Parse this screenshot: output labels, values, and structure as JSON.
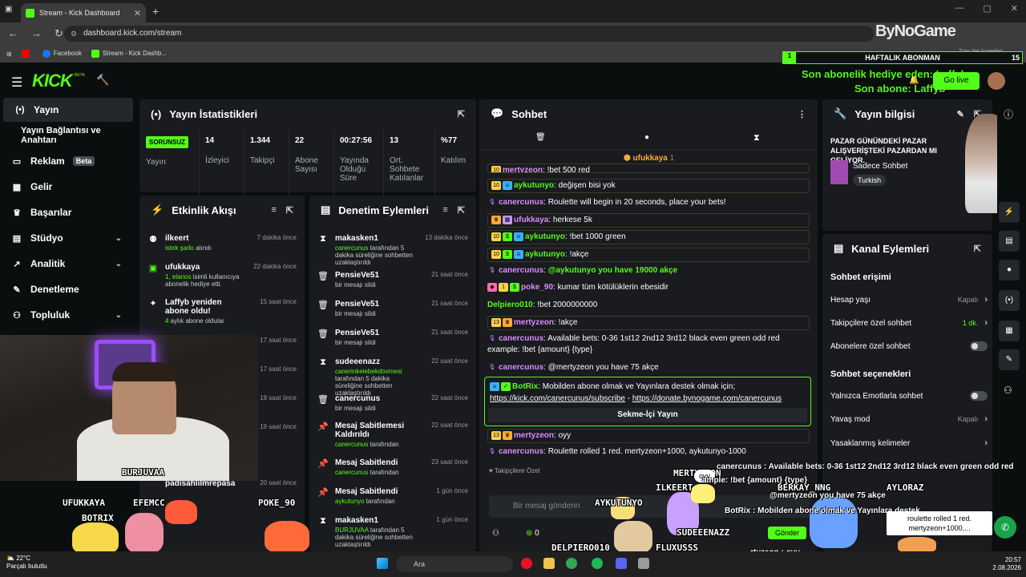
{
  "browser": {
    "tab_title": "Stream - Kick Dashboard",
    "url": "dashboard.kick.com/stream",
    "bookmarks": [
      "Facebook",
      "Stream - Kick Dashb..."
    ],
    "all_bookmarks": "Tüm Yer İşaretleri",
    "logo_overlay": "ByNoGame"
  },
  "overlay_top": {
    "weekly_label": "HAFTALIK ABONMAN",
    "weekly_left": "1",
    "weekly_right": "15",
    "gift_msg": "Son abonelik hediye eden: Laffyba",
    "last_sub": "Son abone: Laffyb"
  },
  "header": {
    "logo": "KICK",
    "beta": "BETA",
    "go_live": "Go live"
  },
  "sidebar": {
    "items": [
      {
        "label": "Yayın",
        "icon": "((•))"
      },
      {
        "label": "Yayın Bağlantısı ve Anahtarı",
        "icon": ""
      },
      {
        "label": "Reklam",
        "icon": "▭",
        "badge": "Beta"
      },
      {
        "label": "Gelir",
        "icon": "▦"
      },
      {
        "label": "Başarılar",
        "icon": "🏆"
      },
      {
        "label": "Stüdyo",
        "icon": "▤"
      },
      {
        "label": "Analitik",
        "icon": "📈"
      },
      {
        "label": "Denetleme",
        "icon": "🔧"
      },
      {
        "label": "Topluluk",
        "icon": "👥"
      }
    ]
  },
  "stats": {
    "title": "Yayın İstatistikleri",
    "status_badge": "SORUNSUZ",
    "cols": [
      {
        "value": "",
        "label": "Yayın"
      },
      {
        "value": "14",
        "label": "İzleyici"
      },
      {
        "value": "1.344",
        "label": "Takipçi"
      },
      {
        "value": "22",
        "label": "Abone Sayısı"
      },
      {
        "value": "00:27:56",
        "label": "Yayında Olduğu Süre"
      },
      {
        "value": "13",
        "label": "Ort. Sohbete Katılanlar"
      },
      {
        "value": "%77",
        "label": "Katılım"
      }
    ]
  },
  "activity": {
    "title": "Etkinlik Akışı",
    "items": [
      {
        "name": "ilkeert",
        "sub_hl": "istek şarkı",
        "sub": " alındı",
        "time": "7 dakika önce"
      },
      {
        "name": "ufukkaya",
        "sub_hl": "1, elanos",
        "sub": " isimli kullanıcıya abonelik hediye etti.",
        "time": "22 dakika önce"
      },
      {
        "name": "Laffyb yeniden abone oldu!",
        "sub_hl": "4",
        "sub": " aylık abone oldular",
        "time": "15 saat önce"
      },
      {
        "name": "",
        "sub_hl": "",
        "sub": "",
        "time": "17 saat önce"
      },
      {
        "name": "",
        "sub_hl": "",
        "sub": "",
        "time": "17 saat önce"
      },
      {
        "name": "",
        "sub_hl": "",
        "sub": "",
        "time": "19 saat önce"
      },
      {
        "name": "",
        "sub_hl": "",
        "sub": "",
        "time": "19 saat önce"
      },
      {
        "name": "padisahlilmrepasa",
        "sub_hl": "",
        "sub": "",
        "time": "20 saat önce"
      }
    ]
  },
  "moderation": {
    "title": "Denetim Eylemleri",
    "items": [
      {
        "icon": "⧗",
        "name": "makasken1",
        "sub_hl": "canercunus",
        "sub": " tarafından 5 dakika süreliğine sohbetten uzaklaştırıldı",
        "time": "13 dakika önce"
      },
      {
        "icon": "🗑",
        "name": "PensieVe51",
        "sub_hl": "",
        "sub": "bir mesajı sildi",
        "time": "21 saat önce"
      },
      {
        "icon": "🗑",
        "name": "PensieVe51",
        "sub_hl": "",
        "sub": "bir mesajı sildi",
        "time": "21 saat önce"
      },
      {
        "icon": "🗑",
        "name": "PensieVe51",
        "sub_hl": "",
        "sub": "bir mesajı sildi",
        "time": "21 saat önce"
      },
      {
        "icon": "⧗",
        "name": "sudeeenazz",
        "sub_hl": "canerinkelebekdovmesi",
        "sub": " tarafından 5 dakika süreliğine sohbetten uzaklaştırıldı",
        "time": "22 saat önce"
      },
      {
        "icon": "🗑",
        "name": "canercunus",
        "sub_hl": "",
        "sub": "bir mesajı sildi",
        "time": "22 saat önce"
      },
      {
        "icon": "📌",
        "name": "Mesaj Sabitlemesi Kaldırıldı",
        "sub_hl": "canercunus",
        "sub": " tarafından",
        "time": "22 saat önce"
      },
      {
        "icon": "📌",
        "name": "Mesaj Sabitlendi",
        "sub_hl": "canercunus",
        "sub": " tarafından",
        "time": "23 saat önce"
      },
      {
        "icon": "📌",
        "name": "Mesaj Sabitlendi",
        "sub_hl": "aykutunyo",
        "sub": " tarafından",
        "time": "1 gün önce"
      },
      {
        "icon": "⧗",
        "name": "makasken1",
        "sub_hl": "BURJUVAA",
        "sub": " tarafından 5 dakika süreliğine sohbetten uzaklaştırıldı",
        "time": "1 gün önce"
      }
    ]
  },
  "chat": {
    "title": "Sohbet",
    "pinned_user": "ufukkaya",
    "pinned_count": "1",
    "messages": [
      {
        "user": "mertyzeon",
        "cls": "u-pink",
        "text": "!bet 500 red"
      },
      {
        "user": "aykutunyo",
        "cls": "u-green",
        "text": "değişen bisi yok"
      },
      {
        "user": "canercunus",
        "cls": "u-green",
        "text": "Roulette will begin in 20 seconds, place your bets!"
      },
      {
        "user": "ufukkaya",
        "cls": "u-pink",
        "text": "herkese 5k"
      },
      {
        "user": "aykutunyo",
        "cls": "u-green",
        "text": "!bet 1000 green"
      },
      {
        "user": "aykutunyo",
        "cls": "u-green",
        "text": "!akçe"
      },
      {
        "user": "canercunus",
        "cls": "u-green",
        "text": "@aykutunyo you have 19000 akçe"
      },
      {
        "user": "poke_90",
        "cls": "u-pink",
        "text": "kumar tüm kötülüklerin ebesidir"
      },
      {
        "user": "Delpiero010",
        "cls": "u-green",
        "text": "!bet 2000000000"
      },
      {
        "user": "mertyzeon",
        "cls": "u-pink",
        "text": "!akçe"
      },
      {
        "user": "canercunus",
        "cls": "u-green",
        "text": "Available bets: 0-36 1st12 2nd12 3rd12 black even green odd red example: !bet {amount} {type}"
      },
      {
        "user": "canercunus",
        "cls": "u-green",
        "text": "@mertyzeon you have 75 akçe"
      }
    ],
    "botrix": {
      "user": "BotRix",
      "text": "Mobilden abone olmak ve Yayınlara destek olmak için;",
      "link1": "https://kick.com/canercunus/subscribe",
      "sep": " - ",
      "link2": "https://donate.bynogame.com/canercunus",
      "button": "Sekme-İçi Yayın"
    },
    "after": [
      {
        "user": "mertyzeon",
        "cls": "u-pink",
        "text": "oyy"
      },
      {
        "user": "canercunus",
        "cls": "u-green",
        "text": "Roulette rolled 1 red. mertyzeon+1000, aykutunyo-1000"
      }
    ],
    "followers_only": "Takipçilere Özel",
    "input_placeholder": "Bir mesaj gönderin",
    "points": "0",
    "send": "Gönder"
  },
  "stream_info": {
    "title": "Yayın bilgisi",
    "stream_title": "PAZAR GÜNÜNDEKİ PAZAR ALIŞVERİŞTEKİ PAZARDAN MI GELİYOR.",
    "category": "Sadece Sohbet",
    "tag": "Turkish"
  },
  "channel_actions": {
    "title": "Kanal Eylemleri",
    "section1": "Sohbet erişimi",
    "rows1": [
      {
        "label": "Hesap yaşı",
        "value": "Kapalı",
        "type": "chev"
      },
      {
        "label": "Takipçilere özel sohbet",
        "value": "1 dk.",
        "type": "chev"
      },
      {
        "label": "Abonelere özel sohbet",
        "value": "",
        "type": "toggle"
      }
    ],
    "section2": "Sohbet seçenekleri",
    "rows2": [
      {
        "label": "Yalnızca Emotlarla sohbet",
        "value": "",
        "type": "toggle"
      },
      {
        "label": "Yavaş mod",
        "value": "Kapalı",
        "type": "chev"
      },
      {
        "label": "Yasaklanmış kelimeler",
        "value": "",
        "type": "chev"
      }
    ]
  },
  "overlay": {
    "names": [
      "BURJUVAA",
      "UFUKKAYA",
      "EFEMCC",
      "BOTRIX",
      "POKE_90",
      "DELPIERO010",
      "AYKUTUNYO",
      "FLUXUSSS",
      "SUDEEENAZZ",
      "ILKEERT",
      "MERTYZEON",
      "BERKAY_NNG",
      "AYLORAZ"
    ],
    "bubble": "oyy",
    "roulette_tooltip": "roulette rolled 1 red. mertyzeon+1000,...",
    "chat_lines": [
      "canercunus : Available bets: 0-36 1st12 2nd12 3rd12 black even green odd red",
      "ample: !bet {amount} {type}",
      "@mertyzeon you have 75 akçe",
      "BotRix : Mobilden abone olmak ve Yayınlara destek",
      "rtyzeon : oyy"
    ]
  },
  "taskbar": {
    "temp": "22°C",
    "weather": "Parçalı bulutlu",
    "search": "Ara",
    "time": "20:57",
    "date": "2.08.2026"
  }
}
